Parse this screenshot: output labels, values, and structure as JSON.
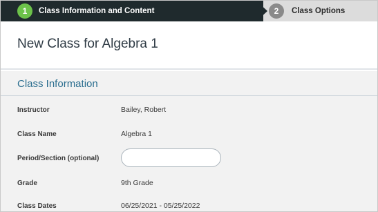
{
  "stepper": {
    "steps": [
      {
        "number": "1",
        "label": "Class Information and Content",
        "state": "active"
      },
      {
        "number": "2",
        "label": "Class Options",
        "state": "inactive"
      }
    ]
  },
  "page": {
    "title": "New Class for Algebra 1"
  },
  "section": {
    "title": "Class Information",
    "fields": [
      {
        "label": "Instructor",
        "value": "Bailey, Robert"
      },
      {
        "label": "Class Name",
        "value": "Algebra 1"
      },
      {
        "label": "Period/Section (optional)",
        "value": "",
        "placeholder": ""
      },
      {
        "label": "Grade",
        "value": "9th Grade"
      },
      {
        "label": "Class Dates",
        "value": "06/25/2021 - 05/25/2022"
      }
    ]
  },
  "colors": {
    "active_step_bg": "#1f2a2d",
    "active_step_badge": "#6cc24a",
    "inactive_step_bg": "#dcdcdc",
    "section_title": "#2b6e8f"
  }
}
